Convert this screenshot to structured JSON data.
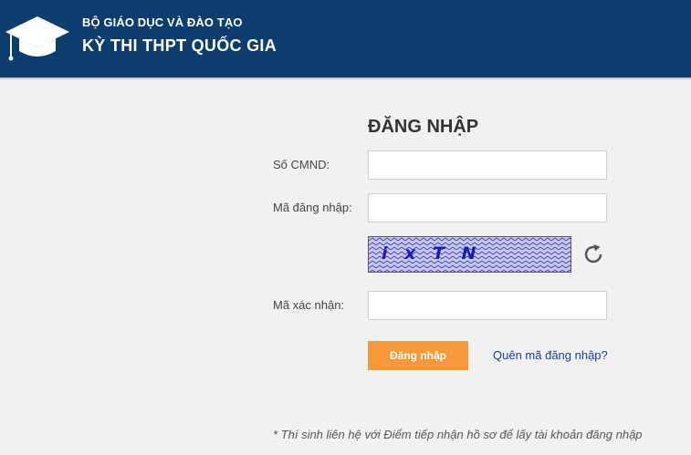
{
  "header": {
    "org": "BỘ GIÁO DỤC VÀ ĐÀO TẠO",
    "title": "KỲ THI THPT QUỐC GIA",
    "logo_icon": "graduation-cap-icon",
    "background_color": "#0d3d6e"
  },
  "login": {
    "title": "ĐĂNG NHẬP",
    "id_label": "Số CMND:",
    "id_value": "",
    "username_label": "Mã đăng nhập:",
    "username_value": "",
    "captcha_text": "i x T N",
    "refresh_icon": "refresh-icon",
    "captcha_label": "Mã xác nhận:",
    "captcha_value": "",
    "submit_label": "Đăng nhập",
    "forgot_link": "Quên mã đăng nhập?",
    "button_color": "#f7993a",
    "link_color": "#1b3f9e"
  },
  "footer_note": "* Thí sinh liên hệ với Điểm tiếp nhận hồ sơ để lấy tài khoản đăng nhập"
}
